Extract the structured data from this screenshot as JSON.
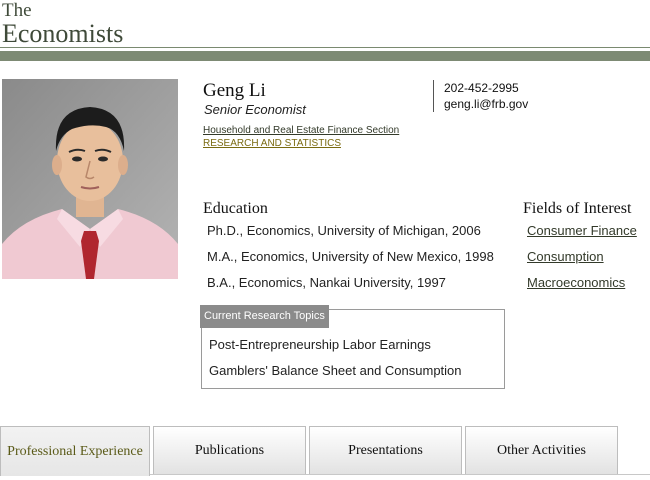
{
  "header": {
    "line1": "The",
    "line2": "Economists"
  },
  "profile": {
    "name": "Geng Li",
    "title": "Senior Economist",
    "section": "Household and Real Estate Finance Section",
    "division": "RESEARCH AND STATISTICS",
    "phone": "202-452-2995",
    "email": "geng.li@frb.gov"
  },
  "education": {
    "heading": "Education",
    "items": [
      "Ph.D., Economics, University of Michigan, 2006",
      "M.A., Economics, University of New Mexico, 1998",
      "B.A., Economics, Nankai University, 1997"
    ]
  },
  "fields": {
    "heading": "Fields of Interest",
    "items": [
      "Consumer Finance",
      "Consumption",
      "Macroeconomics"
    ]
  },
  "research": {
    "tab_label": "Current Research Topics",
    "items": [
      "Post-Entrepreneurship Labor Earnings",
      "Gamblers' Balance Sheet and Consumption"
    ]
  },
  "tabs": [
    {
      "label": "Professional Experience",
      "active": true
    },
    {
      "label": "Publications",
      "active": false
    },
    {
      "label": "Presentations",
      "active": false
    },
    {
      "label": "Other Activities",
      "active": false
    }
  ],
  "colors": {
    "header_bar": "#7d8a74",
    "header_text": "#3f4a39",
    "division_link": "#7a6a10",
    "research_tab_bg": "#8b8b8b",
    "active_tab_text": "#5a5a18"
  }
}
